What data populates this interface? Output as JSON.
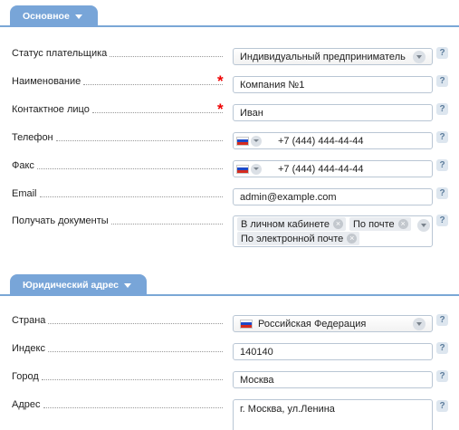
{
  "sections": {
    "main": {
      "title": "Основное"
    },
    "legal": {
      "title": "Юридический адрес"
    }
  },
  "fields": {
    "payer_status": {
      "label": "Статус плательщика",
      "value": "Индивидуальный предприниматель"
    },
    "name": {
      "label": "Наименование",
      "value": "Компания №1",
      "required": true
    },
    "contact": {
      "label": "Контактное лицо",
      "value": "Иван",
      "required": true
    },
    "phone": {
      "label": "Телефон",
      "value": "+7 (444) 444-44-44"
    },
    "fax": {
      "label": "Факс",
      "value": "+7 (444) 444-44-44"
    },
    "email": {
      "label": "Email",
      "value": "admin@example.com"
    },
    "documents": {
      "label": "Получать документы",
      "chips": [
        "В личном кабинете",
        "По почте",
        "По электронной почте"
      ]
    },
    "country": {
      "label": "Страна",
      "value": "Российская Федерация"
    },
    "zip": {
      "label": "Индекс",
      "value": "140140"
    },
    "city": {
      "label": "Город",
      "value": "Москва"
    },
    "address": {
      "label": "Адрес",
      "value": "г. Москва, ул.Ленина"
    }
  },
  "ui": {
    "help_symbol": "?",
    "required_mark": "*",
    "chip_remove": "×"
  },
  "colors": {
    "accent": "#78a5d8",
    "required": "#e00000",
    "border": "#b9c6d4"
  }
}
